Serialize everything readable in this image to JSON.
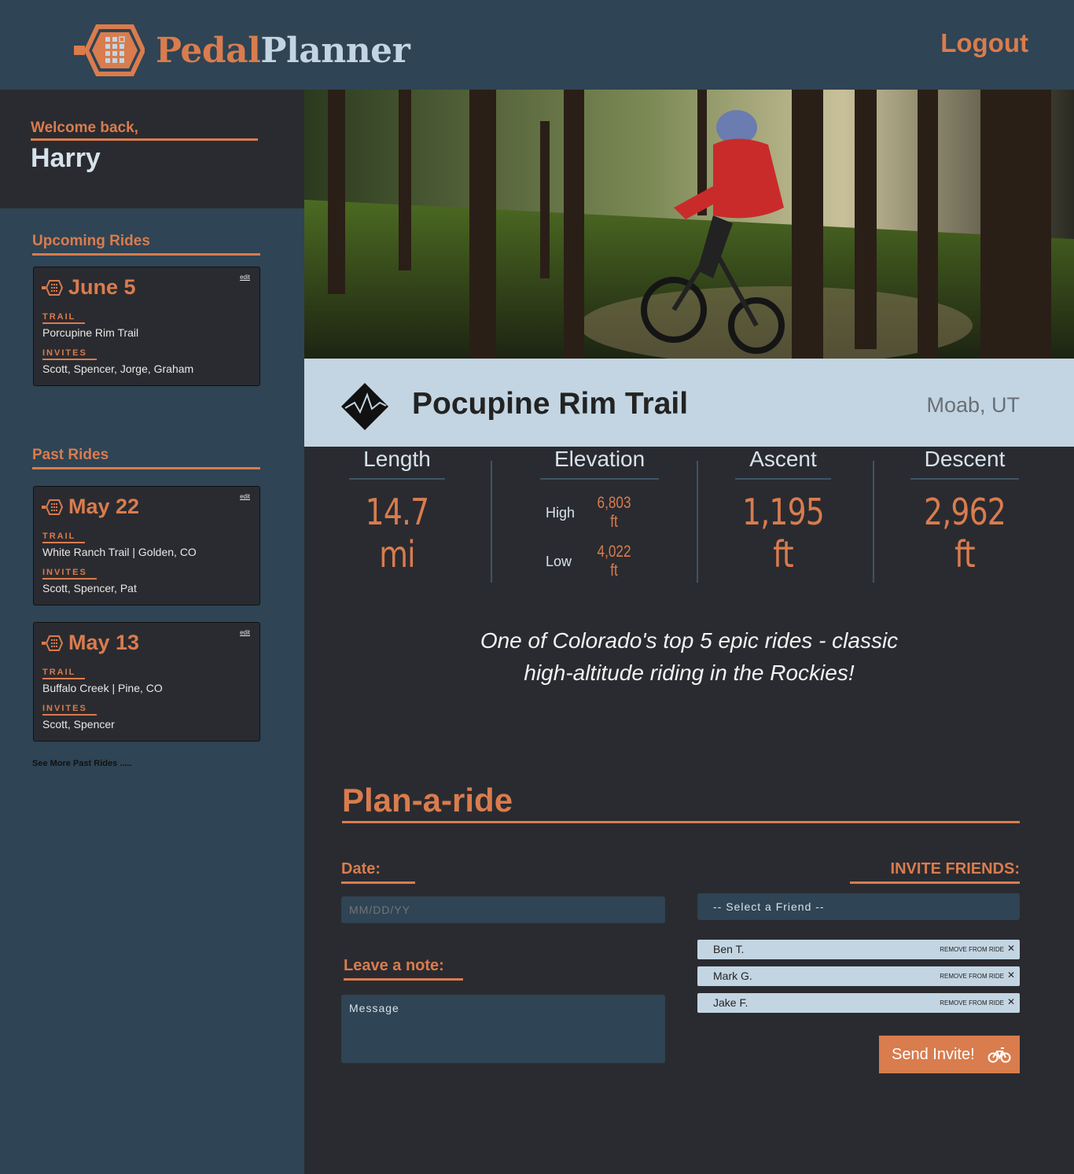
{
  "header": {
    "brand_part1": "Pedal",
    "brand_part2": "Planner",
    "logout_label": "Logout"
  },
  "sidebar": {
    "welcome_label": "Welcome back,",
    "user_name": "Harry",
    "upcoming_title": "Upcoming Rides",
    "past_title": "Past Rides",
    "see_more": "See More Past Rides .....",
    "upcoming": [
      {
        "date": "June 5",
        "edit": "edit",
        "trail_label": "TRAIL",
        "trail": "Porcupine Rim Trail",
        "invites_label": "INVITES",
        "invites": "Scott, Spencer, Jorge, Graham"
      }
    ],
    "past": [
      {
        "date": "May 22",
        "edit": "edit",
        "trail_label": "TRAIL",
        "trail": "White Ranch Trail | Golden, CO",
        "invites_label": "INVITES",
        "invites": "Scott, Spencer, Pat"
      },
      {
        "date": "May 13",
        "edit": "edit",
        "trail_label": "TRAIL",
        "trail": "Buffalo Creek | Pine, CO",
        "invites_label": "INVITES",
        "invites": "Scott, Spencer"
      }
    ]
  },
  "trail": {
    "name": "Pocupine Rim Trail",
    "location": "Moab, UT",
    "quote_line1": "One of Colorado's top 5 epic rides - classic",
    "quote_line2": "high-altitude riding in the Rockies!"
  },
  "stats": {
    "length_title": "Length",
    "length_value": "14.7 mi",
    "elevation_title": "Elevation",
    "high_label": "High",
    "high_value": "6,803 ft",
    "low_label": "Low",
    "low_value": "4,022 ft",
    "ascent_title": "Ascent",
    "ascent_value": "1,195 ft",
    "descent_title": "Descent",
    "descent_value": "2,962 ft"
  },
  "plan": {
    "title": "Plan-a-ride",
    "date_label": "Date:",
    "date_placeholder": "MM/DD/YY",
    "note_label": "Leave a note:",
    "note_placeholder": "Message",
    "invite_label": "INVITE FRIENDS:",
    "select_placeholder": "-- Select a Friend --",
    "remove_label": "REMOVE FROM RIDE",
    "remove_x": "✕",
    "friends": [
      "Ben T.",
      "Mark G.",
      "Jake F."
    ],
    "send_label": "Send Invite!"
  },
  "colors": {
    "accent": "#d97c4e",
    "header_bg": "#2f4454",
    "panel_dark": "#2a2b30",
    "light_blue": "#c3d5e2"
  }
}
